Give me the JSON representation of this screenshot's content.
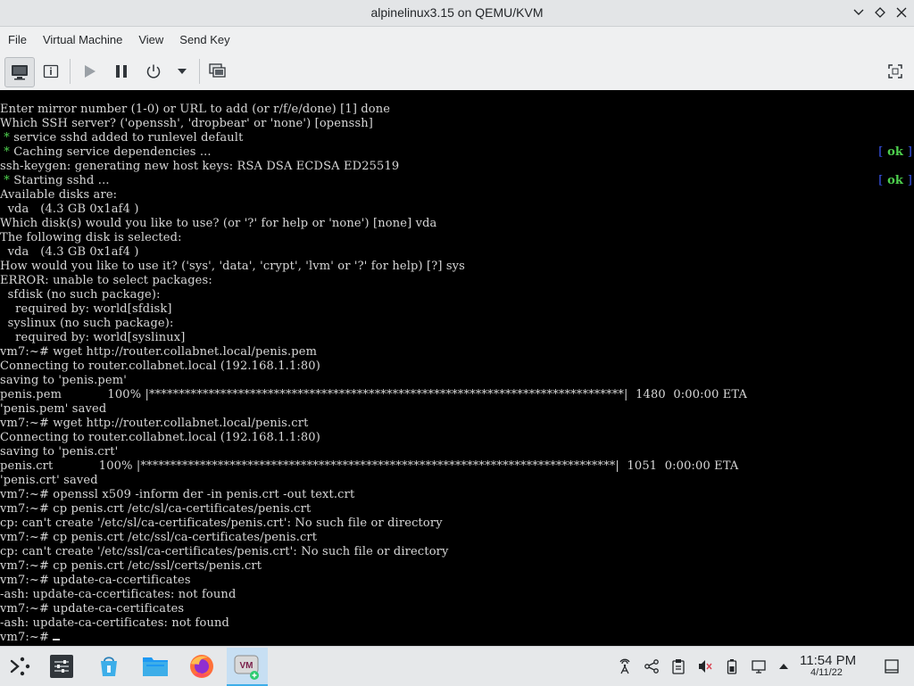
{
  "window": {
    "title": "alpinelinux3.15 on QEMU/KVM",
    "controls": [
      "minimize-icon",
      "maximize-icon",
      "close-icon"
    ]
  },
  "menu": [
    "File",
    "Virtual Machine",
    "View",
    "Send Key"
  ],
  "toolbar": {
    "buttons": [
      "console-icon",
      "details-icon",
      "run-icon",
      "pause-icon",
      "power-icon",
      "power-menu-chevron-icon",
      "snapshots-icon",
      "fullscreen-icon"
    ]
  },
  "console": {
    "lines": [
      "Enter mirror number (1-0) or URL to add (or r/f/e/done) [1] done",
      "Which SSH server? ('openssh', 'dropbear' or 'none') [openssh]",
      " service sshd added to runlevel default",
      " Caching service dependencies ...",
      "ssh-keygen: generating new host keys: RSA DSA ECDSA ED25519",
      " Starting sshd ...",
      "Available disks are:",
      "  vda   (4.3 GB 0x1af4 )",
      "Which disk(s) would you like to use? (or '?' for help or 'none') [none] vda",
      "The following disk is selected:",
      "  vda   (4.3 GB 0x1af4 )",
      "How would you like to use it? ('sys', 'data', 'crypt', 'lvm' or '?' for help) [?] sys",
      "ERROR: unable to select packages:",
      "  sfdisk (no such package):",
      "    required by: world[sfdisk]",
      "  syslinux (no such package):",
      "    required by: world[syslinux]",
      "vm7:~# wget http://router.collabnet.local/penis.pem",
      "Connecting to router.collabnet.local (192.168.1.1:80)",
      "saving to 'penis.pem'",
      "penis.pem            100% |********************************************************************************|  1480  0:00:00 ETA",
      "'penis.pem' saved",
      "vm7:~# wget http://router.collabnet.local/penis.crt",
      "Connecting to router.collabnet.local (192.168.1.1:80)",
      "saving to 'penis.crt'",
      "penis.crt            100% |********************************************************************************|  1051  0:00:00 ETA",
      "'penis.crt' saved",
      "vm7:~# openssl x509 -inform der -in penis.crt -out text.crt",
      "vm7:~# cp penis.crt /etc/sl/ca-certificates/penis.crt",
      "cp: can't create '/etc/sl/ca-certificates/penis.crt': No such file or directory",
      "vm7:~# cp penis.crt /etc/ssl/ca-certificates/penis.crt",
      "cp: can't create '/etc/ssl/ca-certificates/penis.crt': No such file or directory",
      "vm7:~# cp penis.crt /etc/ssl/certs/penis.crt",
      "vm7:~# update-ca-ccertificates",
      "-ash: update-ca-ccertificates: not found",
      "vm7:~# update-ca-certificates",
      "-ash: update-ca-certificates: not found",
      "vm7:~# "
    ],
    "star_lines": [
      2,
      3,
      5
    ],
    "ok_lines": [
      3,
      5
    ],
    "ok_open": "[",
    "ok_text": " ok ",
    "ok_close": "]",
    "text_color": "#d8d8d8",
    "ok_color": "#4ed14e",
    "bracket_color": "#3d5bff"
  },
  "taskbar": {
    "apps": [
      "application-launcher-icon",
      "system-settings-icon",
      "discover-store-icon",
      "file-manager-icon",
      "firefox-icon",
      "virt-manager-icon"
    ],
    "tray": [
      "network-activity-icon",
      "kdeconnect-icon",
      "clipboard-icon",
      "volume-muted-icon",
      "battery-icon",
      "display-config-icon",
      "tray-expand-icon"
    ],
    "time": "11:54 PM",
    "date": "4/11/22"
  }
}
